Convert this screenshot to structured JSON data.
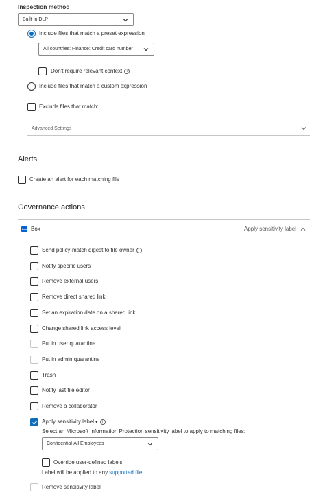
{
  "inspection": {
    "heading": "Inspection method",
    "method_value": "Built-in DLP",
    "radio_preset": "Include files that match a preset expression",
    "preset_value": "All countries: Finance: Credit card number",
    "dont_require_context": "Don't require relevant context",
    "radio_custom": "Include files that match a custom expression",
    "exclude_files": "Exclude files that match:",
    "advanced_settings": "Advanced Settings"
  },
  "alerts": {
    "heading": "Alerts",
    "create_alert": "Create an alert for each matching file"
  },
  "governance": {
    "heading": "Governance actions",
    "app_name": "Box",
    "app_summary": "Apply sensitivity label",
    "actions": [
      {
        "label": "Send policy-match digest to file owner",
        "checked": false,
        "disabled": false,
        "info": true
      },
      {
        "label": "Notify specific users",
        "checked": false,
        "disabled": false
      },
      {
        "label": "Remove external users",
        "checked": false,
        "disabled": false
      },
      {
        "label": "Remove direct shared link",
        "checked": false,
        "disabled": false
      },
      {
        "label": "Set an expiration date on a shared link",
        "checked": false,
        "disabled": false
      },
      {
        "label": "Change shared link access level",
        "checked": false,
        "disabled": false
      },
      {
        "label": "Put in user quarantine",
        "checked": false,
        "disabled": true
      },
      {
        "label": "Put in admin quarantine",
        "checked": false,
        "disabled": true
      },
      {
        "label": "Trash",
        "checked": false,
        "disabled": false
      },
      {
        "label": "Notify last file editor",
        "checked": false,
        "disabled": false
      },
      {
        "label": "Remove a collaborator",
        "checked": false,
        "disabled": false
      },
      {
        "label": "Apply sensitivity label",
        "checked": true,
        "disabled": false
      }
    ],
    "sensitivity_prompt": "Select an Microsoft Information Protection sensitivity label to apply to matching files:",
    "sensitivity_value": "Confidential-All Employees",
    "override_labels": "Override user-defined labels",
    "applied_note_prefix": "Label will be applied to any ",
    "applied_note_link": "supported file",
    "applied_note_suffix": ".",
    "remove_label": "Remove sensitivity label"
  },
  "colors": {
    "accent": "#0f6cbd",
    "box_brand": "#0061d5"
  }
}
